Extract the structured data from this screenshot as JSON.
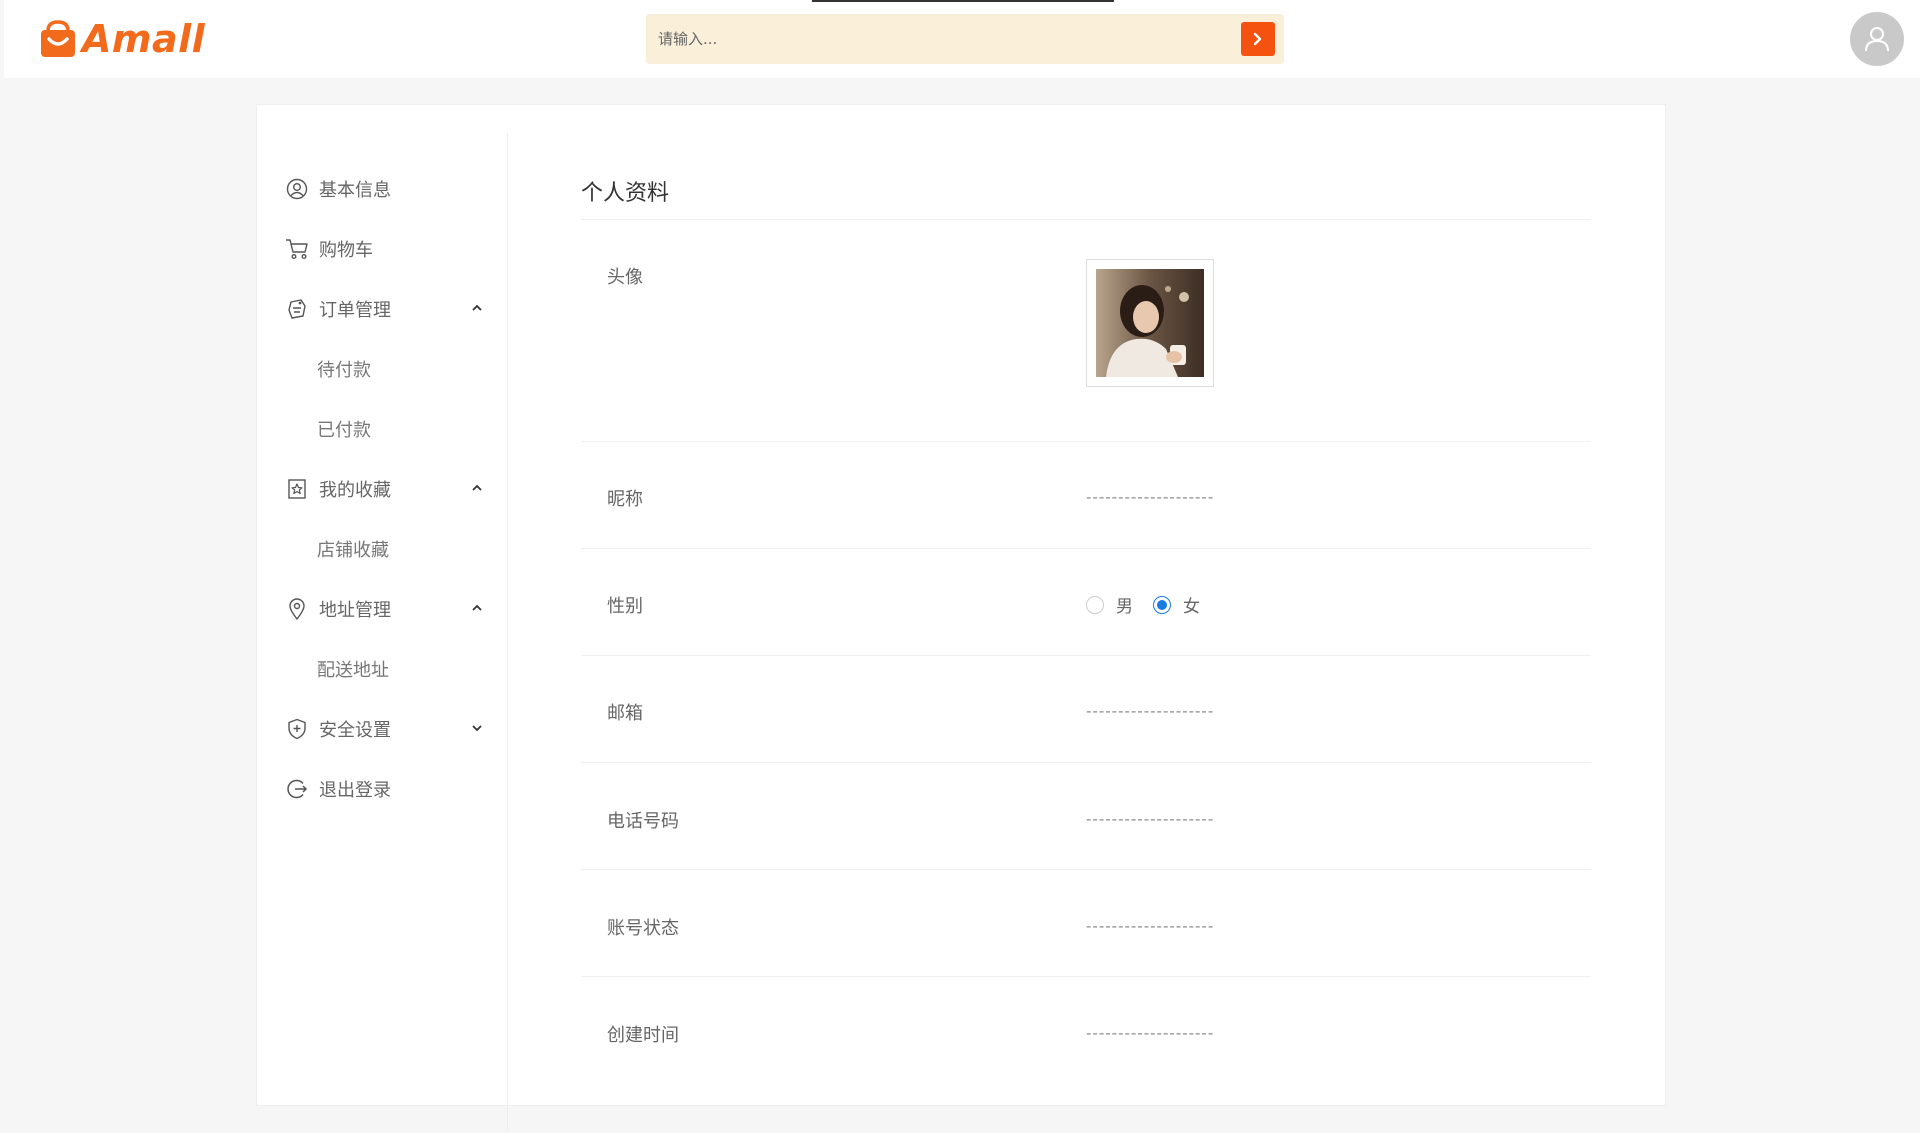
{
  "header": {
    "logo_text": "Amall",
    "search_placeholder": "请输入...",
    "accent_color": "#f5520f"
  },
  "sidebar": {
    "items": [
      {
        "label": "基本信息",
        "icon": "user-circle-icon"
      },
      {
        "label": "购物车",
        "icon": "cart-icon"
      },
      {
        "label": "订单管理",
        "icon": "order-icon",
        "expanded": true,
        "children": [
          "待付款",
          "已付款"
        ]
      },
      {
        "label": "我的收藏",
        "icon": "bookmark-star-icon",
        "expanded": true,
        "children": [
          "店铺收藏"
        ]
      },
      {
        "label": "地址管理",
        "icon": "location-pin-icon",
        "expanded": true,
        "children": [
          "配送地址"
        ]
      },
      {
        "label": "安全设置",
        "icon": "shield-icon",
        "expanded": false
      },
      {
        "label": "退出登录",
        "icon": "logout-icon"
      }
    ]
  },
  "profile": {
    "title": "个人资料",
    "avatar_label": "头像",
    "nickname": {
      "label": "昵称",
      "value": "--------------------"
    },
    "gender": {
      "label": "性别",
      "options": [
        "男",
        "女"
      ],
      "selected": "女"
    },
    "email": {
      "label": "邮箱",
      "value": "--------------------"
    },
    "phone": {
      "label": "电话号码",
      "value": "--------------------"
    },
    "account_status": {
      "label": "账号状态",
      "value": "--------------------"
    },
    "created_time": {
      "label": "创建时间",
      "value": "--------------------"
    }
  }
}
